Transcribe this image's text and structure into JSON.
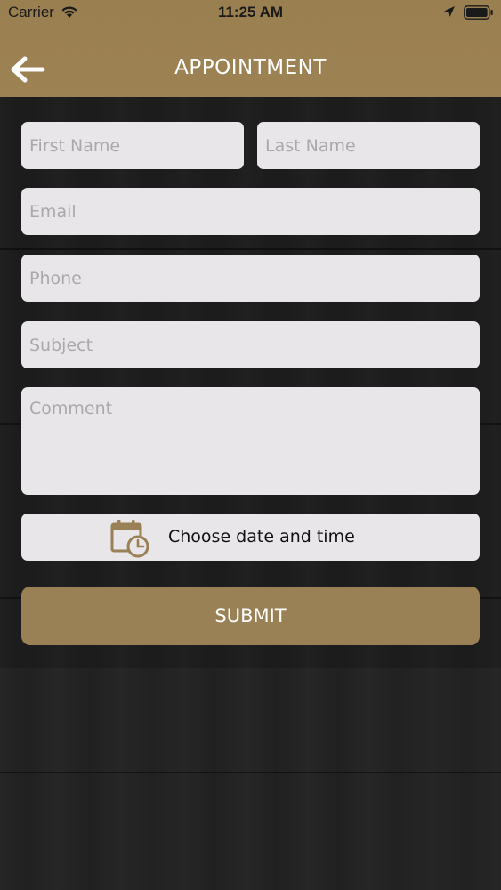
{
  "status_bar": {
    "carrier": "Carrier",
    "time": "11:25 AM"
  },
  "header": {
    "title": "APPOINTMENT",
    "back_icon": "arrow-left-icon"
  },
  "form": {
    "first_name": {
      "placeholder": "First Name",
      "value": ""
    },
    "last_name": {
      "placeholder": "Last Name",
      "value": ""
    },
    "email": {
      "placeholder": "Email",
      "value": ""
    },
    "phone": {
      "placeholder": "Phone",
      "value": ""
    },
    "subject": {
      "placeholder": "Subject",
      "value": ""
    },
    "comment": {
      "placeholder": "Comment",
      "value": ""
    },
    "date_picker": {
      "label": "Choose date and time",
      "icon": "calendar-clock-icon"
    },
    "submit_label": "SUBMIT"
  },
  "colors": {
    "brand": "#9a8055",
    "field_background": "#e8e6e9",
    "placeholder": "#a9a8ab",
    "background": "#222222"
  }
}
